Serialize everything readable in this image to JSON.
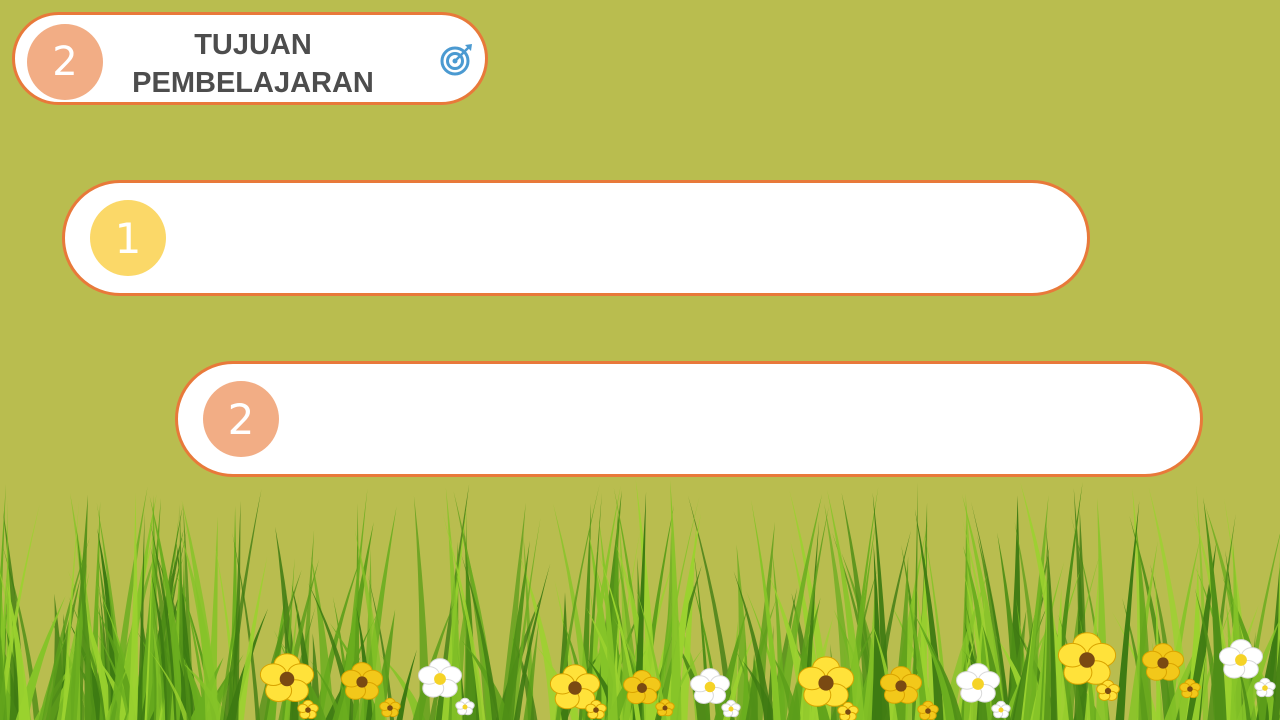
{
  "header": {
    "number": "2",
    "title_line1": "TUJUAN",
    "title_line2": "PEMBELAJARAN",
    "icon": "target-icon"
  },
  "objectives": [
    {
      "number": "1",
      "text": ""
    },
    {
      "number": "2",
      "text": ""
    }
  ],
  "colors": {
    "background": "#b9bd4f",
    "border": "#e8793a",
    "peach": "#f2ad85",
    "yellow": "#fbd868",
    "title_text": "#4d4d4d",
    "icon_blue": "#4b9ad1"
  }
}
